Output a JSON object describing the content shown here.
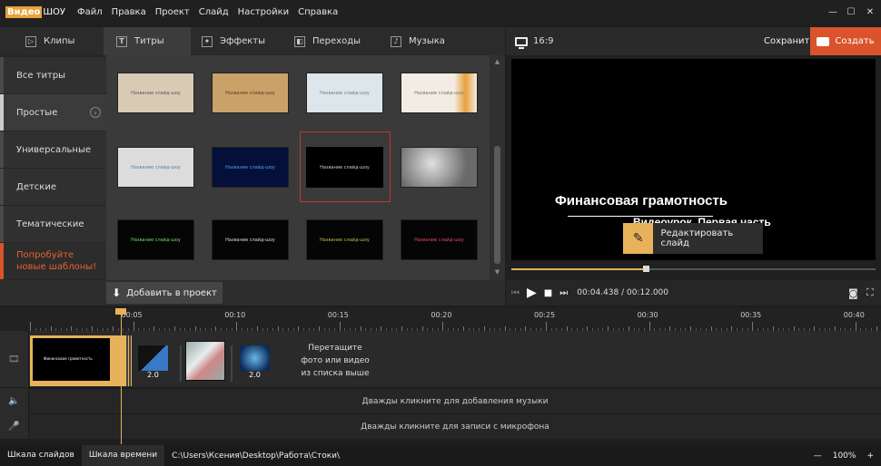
{
  "app": {
    "logo_part1": "Видео",
    "logo_part2": "ШОУ"
  },
  "menu": [
    "Файл",
    "Правка",
    "Проект",
    "Слайд",
    "Настройки",
    "Справка"
  ],
  "window": {
    "minimize": "—",
    "maximize": "☐",
    "close": "✕"
  },
  "tabs": [
    {
      "label": "Клипы",
      "icon": "film-icon"
    },
    {
      "label": "Титры",
      "icon": "text-t-icon"
    },
    {
      "label": "Эффекты",
      "icon": "magic-wand-icon"
    },
    {
      "label": "Переходы",
      "icon": "transition-icon"
    },
    {
      "label": "Музыка",
      "icon": "music-icon"
    }
  ],
  "toolbar": {
    "aspect": "16:9",
    "save_label": "Сохранить",
    "create_label": "Создать"
  },
  "categories": [
    {
      "label": "Все титры"
    },
    {
      "label": "Простые"
    },
    {
      "label": "Универсальные"
    },
    {
      "label": "Детские"
    },
    {
      "label": "Тематические"
    }
  ],
  "promo": {
    "line1": "Попробуйте",
    "line2": "новые шаблоны!"
  },
  "thumbnails": [
    {
      "caption": "Название слайд-шоу",
      "bg": "#d9cbb3"
    },
    {
      "caption": "Название слайд-шоу",
      "bg": "#c9a26a"
    },
    {
      "caption": "Название слайд-шоу",
      "bg": "#dde6ea"
    },
    {
      "caption": "Название слайд-шоу",
      "bg": "#f2ece4"
    },
    {
      "caption": "Название слайд-шоу",
      "bg": "#dcdcdc"
    },
    {
      "caption": "Название слайд-шоу",
      "bg": "#05103a"
    },
    {
      "caption": "Название слайд-шоу",
      "bg": "#000000"
    },
    {
      "caption": "",
      "bg": "#8a8a8a"
    },
    {
      "caption": "Название слайд-шоу",
      "bg": "#050505"
    },
    {
      "caption": "Название слайд-шоу",
      "bg": "#050505"
    },
    {
      "caption": "Название слайд-шоу",
      "bg": "#050505"
    },
    {
      "caption": "Название слайд-шоу",
      "bg": "#050505"
    }
  ],
  "add_to_project": "Добавить в проект",
  "preview": {
    "title": "Финансовая грамотность",
    "subtitle": "Видеоурок. Первая часть",
    "edit_label": "Редактировать слайд",
    "progress": 0.37
  },
  "playback": {
    "current": "00:04.438",
    "separator": "/",
    "total": "00:12.000"
  },
  "ruler": [
    "00:05",
    "00:10",
    "00:15",
    "00:20",
    "00:25",
    "00:30",
    "00:35",
    "00:40"
  ],
  "timeline": {
    "main_clip_text": "Финансовая грамотность",
    "transition1": "2.0",
    "transition2": "2.0",
    "drop_hint": [
      "Перетащите",
      "фото или видео",
      "из списка выше"
    ],
    "music_hint": "Дважды кликните для добавления музыки",
    "mic_hint": "Дважды кликните для записи с микрофона"
  },
  "status": {
    "tab_slides": "Шкала слайдов",
    "tab_timeline": "Шкала времени",
    "path": "C:\\Users\\Ксения\\Desktop\\Работа\\Стоки\\",
    "zoom_minus": "—",
    "zoom": "100%",
    "zoom_plus": "+"
  },
  "colors": {
    "accent": "#e8b25a",
    "create": "#d9532b",
    "promo": "#e8622e"
  }
}
